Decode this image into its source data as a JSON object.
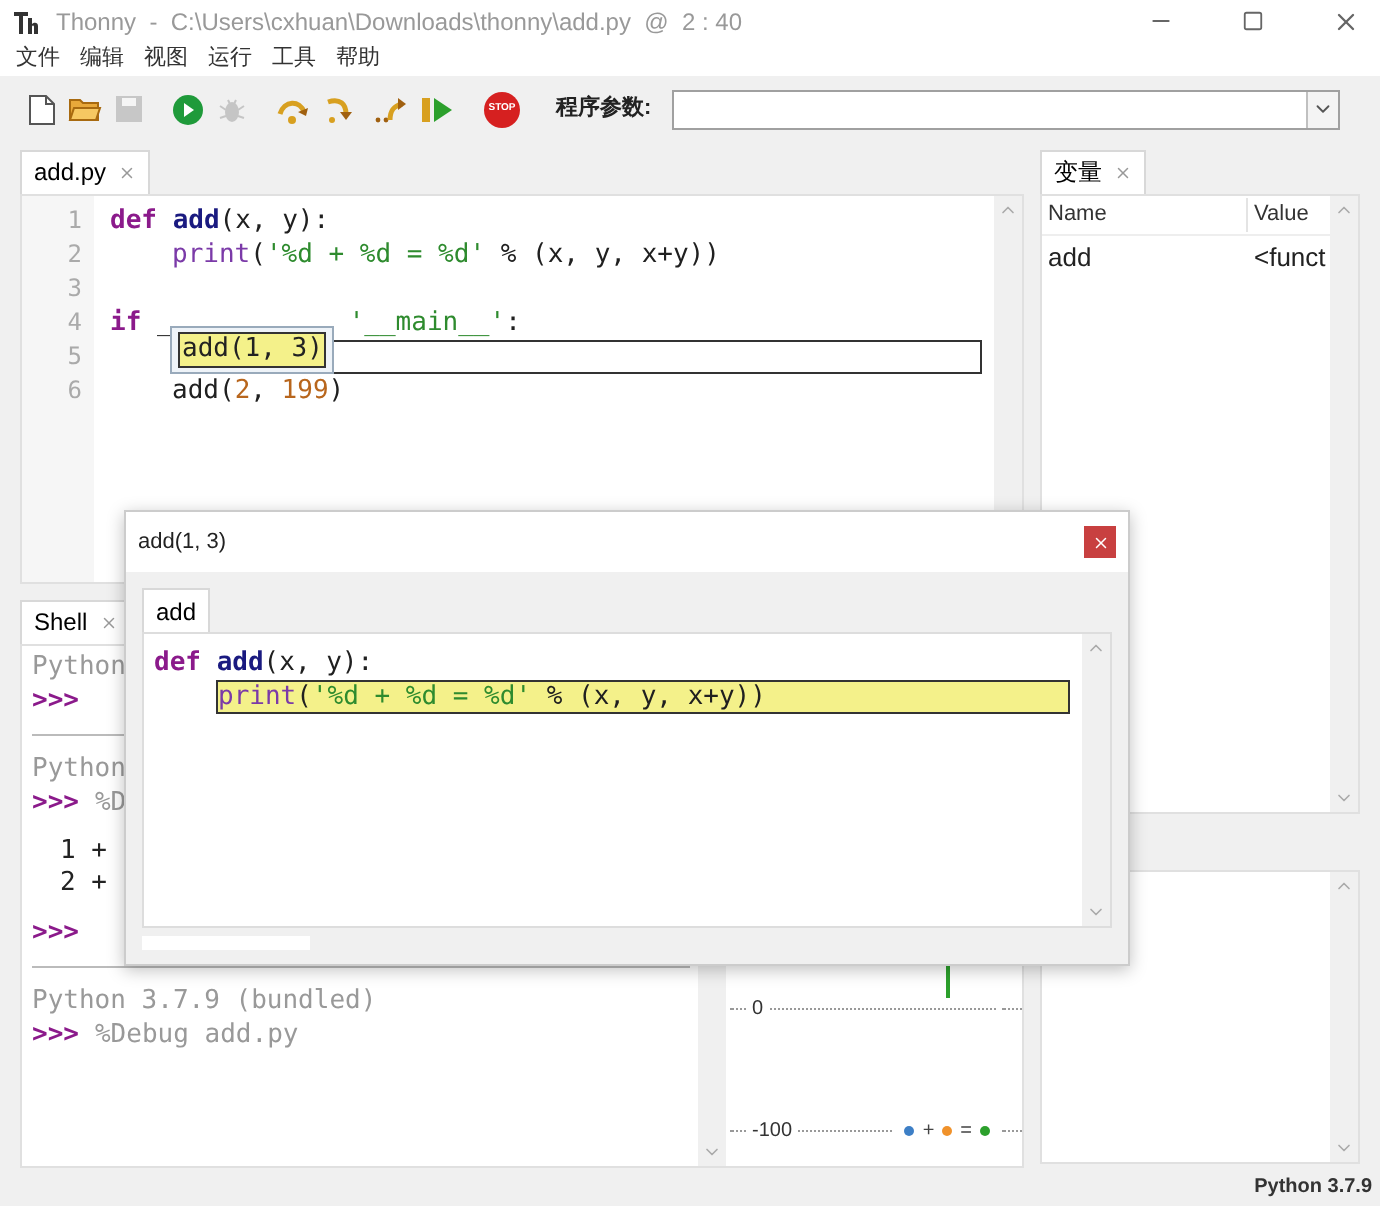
{
  "window": {
    "title": "Thonny  -  C:\\Users\\cxhuan\\Downloads\\thonny\\add.py  @  2 : 40"
  },
  "menu": [
    "文件",
    "编辑",
    "视图",
    "运行",
    "工具",
    "帮助"
  ],
  "toolbar": {
    "buttons": [
      {
        "kind": "new",
        "disabled": false
      },
      {
        "kind": "open",
        "disabled": false
      },
      {
        "kind": "save",
        "disabled": true
      },
      {
        "kind": "run",
        "disabled": false
      },
      {
        "kind": "debug",
        "disabled": true
      },
      {
        "kind": "step_over",
        "disabled": false
      },
      {
        "kind": "step_into",
        "disabled": false
      },
      {
        "kind": "step_out",
        "disabled": false
      },
      {
        "kind": "resume",
        "disabled": false
      },
      {
        "kind": "stop",
        "disabled": false,
        "text": "STOP"
      }
    ],
    "args_label": "程序参数:"
  },
  "editor": {
    "tabs": [
      {
        "label": "add.py",
        "selected": true
      }
    ],
    "lines": [
      {
        "number": "1",
        "indented": false,
        "boxed": false,
        "tokens": [
          {
            "t": "def ",
            "kind": "kw"
          },
          {
            "t": "add",
            "kind": "fn"
          },
          {
            "t": "(x, y):",
            "kind": "plain"
          }
        ]
      },
      {
        "number": "2",
        "indented": true,
        "boxed": false,
        "tokens": [
          {
            "t": "print",
            "kind": "builtin"
          },
          {
            "t": "(",
            "kind": "plain"
          },
          {
            "t": "'%d + %d = %d'",
            "kind": "str"
          },
          {
            "t": " % (x, y, x+y))",
            "kind": "plain"
          }
        ]
      },
      {
        "number": "3",
        "boxed": false
      },
      {
        "number": "4",
        "indented": false,
        "boxed": false,
        "tokens": [
          {
            "t": "if ",
            "kind": "kw"
          },
          {
            "t": "_",
            "kind": "plain"
          },
          {
            "kind": "hidden"
          },
          {
            "t": "'__main__'",
            "kind": "str"
          },
          {
            "t": ":",
            "kind": "plain"
          }
        ]
      },
      {
        "number": "5",
        "indented": true,
        "boxed": true
      },
      {
        "number": "6",
        "indented": true,
        "boxed": false,
        "tokens": [
          {
            "t": "add(",
            "kind": "plain"
          },
          {
            "t": "2",
            "kind": "num"
          },
          {
            "t": ", ",
            "kind": "plain"
          },
          {
            "t": "199",
            "kind": "num"
          },
          {
            "t": ")",
            "kind": "plain"
          }
        ]
      }
    ],
    "popup": {
      "text": "add(1, 3)"
    }
  },
  "variables": {
    "tab": "变量",
    "columns": [
      "Name",
      "Value"
    ],
    "rows": [
      [
        "add",
        "<funct"
      ]
    ]
  },
  "shell": {
    "tab": "Shell",
    "lines": [
      {
        "kind": "info",
        "text": "Python"
      },
      {
        "kind": "prompt",
        "prompt": ">>>"
      },
      {
        "kind": "rule"
      },
      {
        "kind": "info",
        "text": "Python"
      },
      {
        "kind": "prompt",
        "prompt": ">>>",
        "text": "%D"
      },
      {
        "kind": "blank"
      },
      {
        "kind": "output",
        "text": "1 +"
      },
      {
        "kind": "output",
        "text": "2 +"
      },
      {
        "kind": "blank"
      },
      {
        "kind": "prompt",
        "prompt": ">>>"
      },
      {
        "kind": "rule"
      },
      {
        "kind": "info",
        "text": "Python 3.7.9 (bundled)"
      },
      {
        "kind": "prompt",
        "prompt": ">>>",
        "text": "%Debug add.py"
      }
    ]
  },
  "plotter": {
    "ticks": [
      "0",
      "-100"
    ],
    "legend": [
      {
        "kind": "dot",
        "color": "#3d7fc6"
      },
      {
        "kind": "sign",
        "text": "+"
      },
      {
        "kind": "dot",
        "color": "#f0922b"
      },
      {
        "kind": "sign",
        "text": "="
      },
      {
        "kind": "dot",
        "color": "#2ca02c"
      }
    ]
  },
  "dialog": {
    "title": "add(1, 3)",
    "tab": "add",
    "lines": [
      {
        "indented": false,
        "highlighted": false,
        "tokens": [
          {
            "t": "def ",
            "kind": "kw"
          },
          {
            "t": "add",
            "kind": "fn"
          },
          {
            "t": "(x, y):",
            "kind": "plain"
          }
        ]
      },
      {
        "indented": true,
        "highlighted": true,
        "tokens": [
          {
            "t": "print",
            "kind": "builtin"
          },
          {
            "t": "(",
            "kind": "plain"
          },
          {
            "t": "'%d + %d = %d'",
            "kind": "str"
          },
          {
            "t": " % (x, y, x+y))",
            "kind": "plain"
          }
        ]
      }
    ]
  },
  "status_bar": {
    "text": "Python 3.7.9"
  }
}
